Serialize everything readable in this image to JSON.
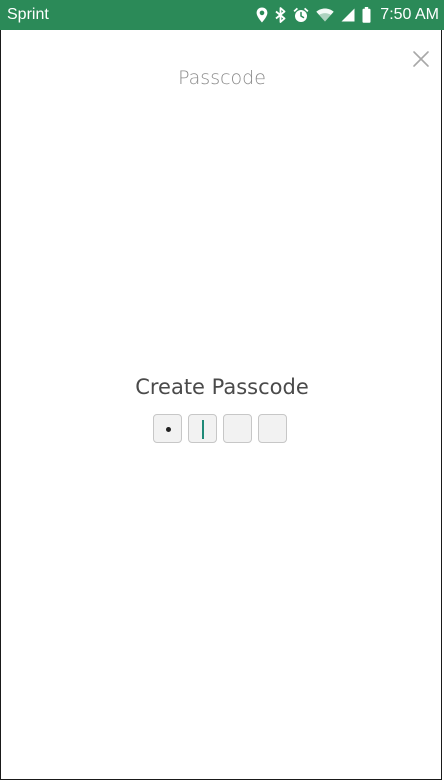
{
  "status_bar": {
    "carrier": "Sprint",
    "time": "7:50 AM",
    "background_color": "#2b8a58",
    "icons": [
      "location-icon",
      "bluetooth-icon",
      "alarm-icon",
      "wifi-icon",
      "signal-icon",
      "battery-icon"
    ]
  },
  "header": {
    "title": "Passcode",
    "close_icon": "close-icon"
  },
  "passcode": {
    "prompt": "Create Passcode",
    "digit_count": 4,
    "digits_entered": 1,
    "active_index": 1,
    "caret_color": "#1f8a78"
  }
}
